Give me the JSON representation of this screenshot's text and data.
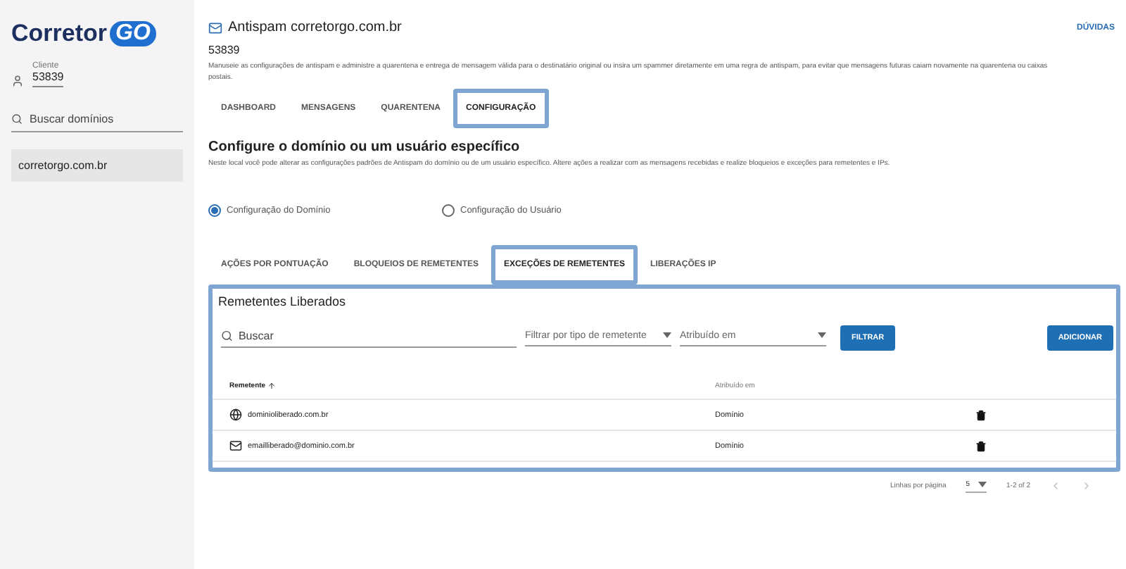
{
  "sidebar": {
    "logo": {
      "word": "Corretor",
      "badge": "GO"
    },
    "client": {
      "label": "Cliente",
      "value": "53839"
    },
    "search": {
      "placeholder": "Buscar domínios"
    },
    "domains": [
      {
        "label": "corretorgo.com.br",
        "selected": true
      }
    ]
  },
  "header": {
    "title": "Antispam corretorgo.com.br",
    "id": "53839",
    "help": "DÚVIDAS",
    "description": "Manuseie as configurações de antispam e administre a quarentena e entrega de mensagem válida para o destinatário original ou insira um spammer diretamente em uma regra de antispam, para evitar que mensagens futuras caiam novamente na quarentena ou caixas postais."
  },
  "tabs": [
    {
      "label": "DASHBOARD",
      "selected": false
    },
    {
      "label": "MENSAGENS",
      "selected": false
    },
    {
      "label": "QUARENTENA",
      "selected": false
    },
    {
      "label": "CONFIGURAÇÃO",
      "selected": true
    }
  ],
  "config": {
    "title": "Configure o domínio ou um usuário específico",
    "description": "Neste local você pode alterar as configurações padrões de Antispam do domínio ou de um usuário específico. Altere ações a realizar com as mensagens recebidas e realize bloqueios e exceções para remetentes e IPs.",
    "modes": [
      {
        "label": "Configuração do Domínio",
        "selected": true
      },
      {
        "label": "Configuração do Usuário",
        "selected": false
      }
    ]
  },
  "subtabs": [
    {
      "label": "AÇÕES POR PONTUAÇÃO",
      "selected": false
    },
    {
      "label": "BLOQUEIOS DE REMETENTES",
      "selected": false
    },
    {
      "label": "EXCEÇÕES DE REMETENTES",
      "selected": true
    },
    {
      "label": "LIBERAÇÕES IP",
      "selected": false
    }
  ],
  "card": {
    "title": "Remetentes Liberados",
    "search": {
      "placeholder": "Buscar"
    },
    "filters": [
      {
        "placeholder": "Filtrar por tipo de remetente"
      },
      {
        "placeholder": "Atribuído em"
      }
    ],
    "filter_button": "FILTRAR",
    "add_button": "ADICIONAR",
    "columns": [
      {
        "label": "Remetente",
        "sorted": true
      },
      {
        "label": "Atribuído em",
        "sorted": false
      }
    ],
    "rows": [
      {
        "kind": "domain",
        "sender": "dominioliberado.com.br",
        "assigned": "Domínio"
      },
      {
        "kind": "email",
        "sender": "emailliberado@dominio.com.br",
        "assigned": "Domínio"
      }
    ]
  },
  "pagination": {
    "label": "Linhas por página",
    "per_page": "5",
    "range": "1-2 of 2"
  }
}
